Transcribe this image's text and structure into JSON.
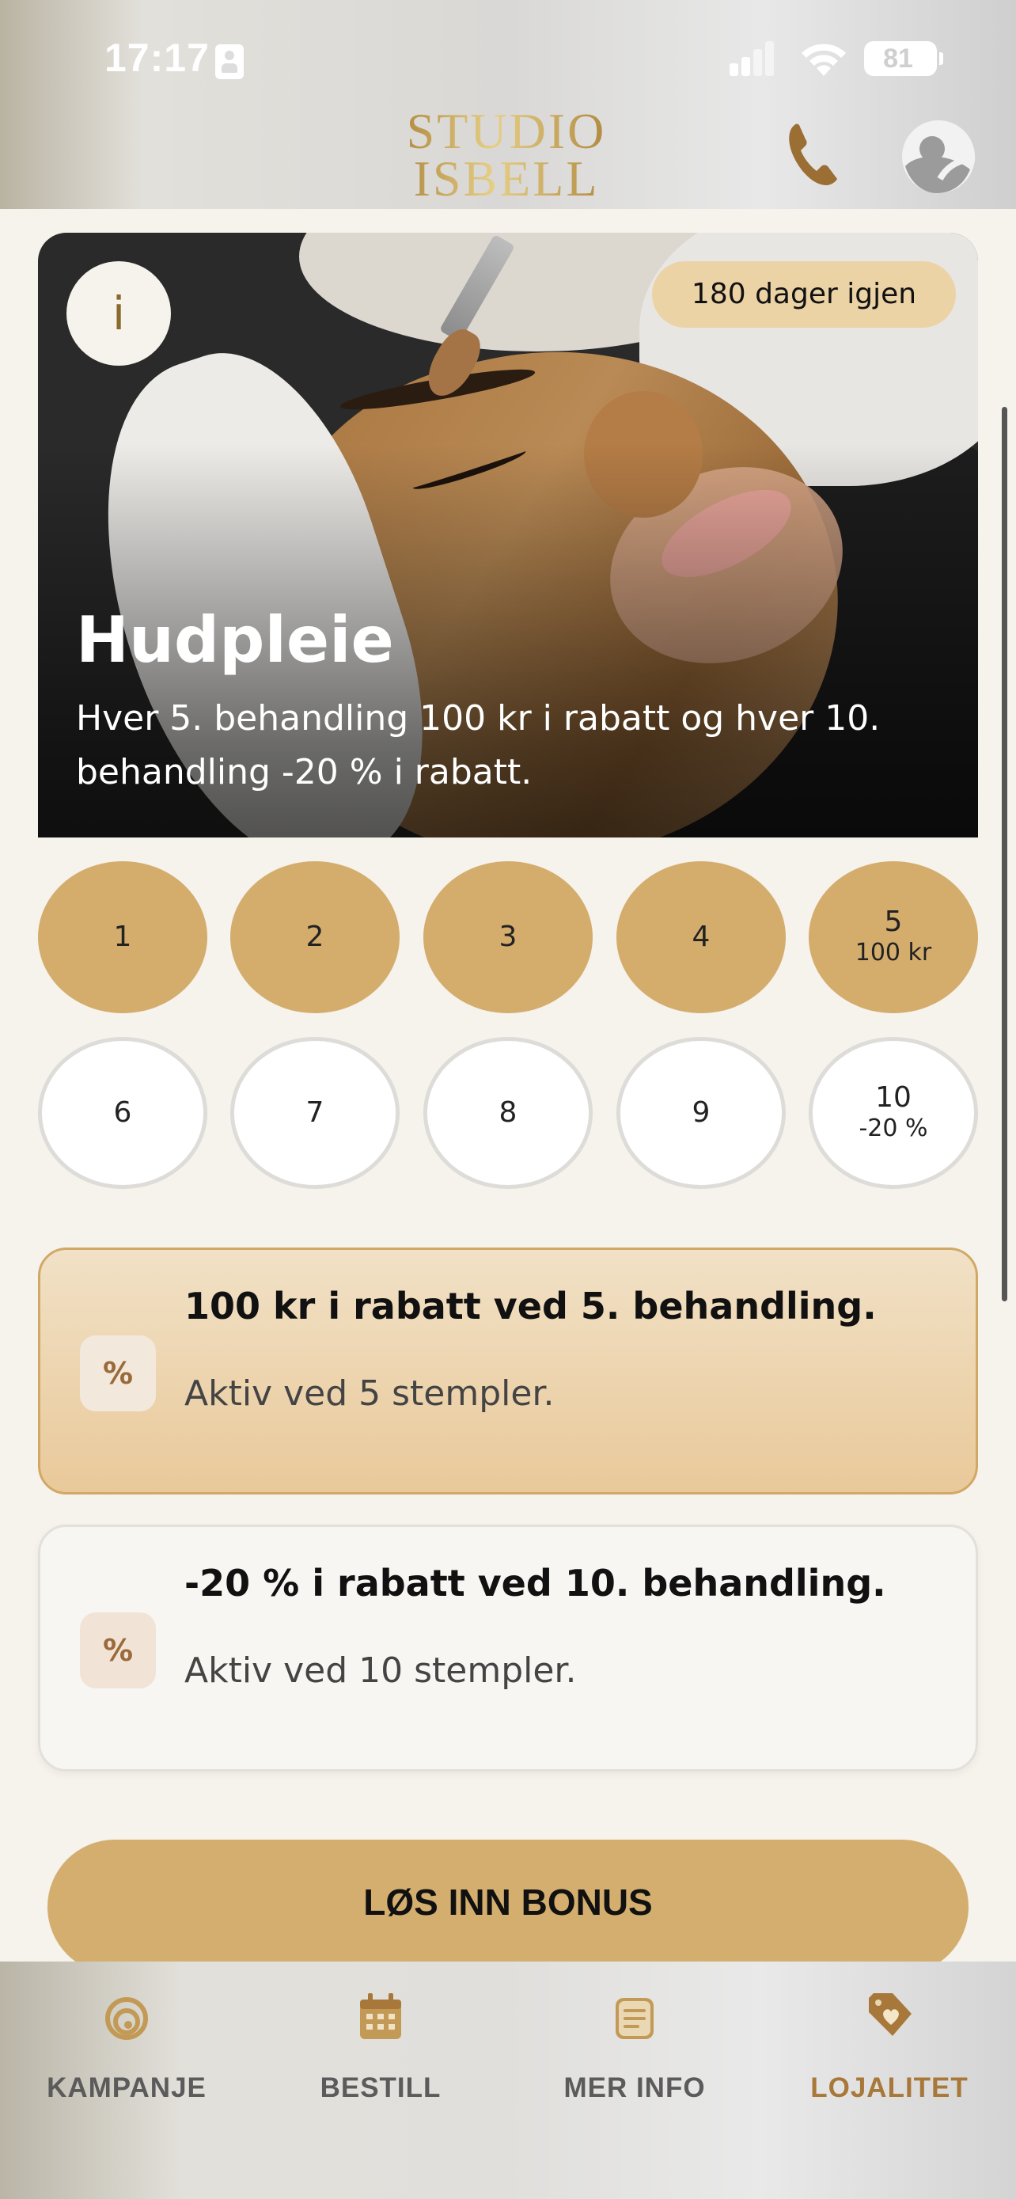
{
  "status_bar": {
    "time": "17:17",
    "battery": "81"
  },
  "header": {
    "logo_line1": "STUDIO",
    "logo_line2": "ISBELL"
  },
  "card": {
    "badge": "180 dager igjen",
    "info_label": "i",
    "title": "Hudpleie",
    "description": "Hver 5. behandling 100 kr i rabatt og hver 10. behandling -20 % i rabatt."
  },
  "stamps": [
    {
      "num": "1",
      "sub": "",
      "filled": true
    },
    {
      "num": "2",
      "sub": "",
      "filled": true
    },
    {
      "num": "3",
      "sub": "",
      "filled": true
    },
    {
      "num": "4",
      "sub": "",
      "filled": true
    },
    {
      "num": "5",
      "sub": "100 kr",
      "filled": true
    },
    {
      "num": "6",
      "sub": "",
      "filled": false
    },
    {
      "num": "7",
      "sub": "",
      "filled": false
    },
    {
      "num": "8",
      "sub": "",
      "filled": false
    },
    {
      "num": "9",
      "sub": "",
      "filled": false
    },
    {
      "num": "10",
      "sub": "-20 %",
      "filled": false
    }
  ],
  "rewards": [
    {
      "icon": "%",
      "title": "100 kr i rabatt ved 5. behandling.",
      "subtitle": "Aktiv ved 5 stempler.",
      "active": true
    },
    {
      "icon": "%",
      "title": "-20 % i rabatt ved 10. behandling.",
      "subtitle": "Aktiv ved 10 stempler.",
      "active": false
    }
  ],
  "redeem_label": "LØS INN BONUS",
  "tabs": [
    {
      "label": "KAMPANJE",
      "icon": "campaign-swirl-icon"
    },
    {
      "label": "BESTILL",
      "icon": "calendar-icon"
    },
    {
      "label": "MER INFO",
      "icon": "document-icon"
    },
    {
      "label": "LOJALITET",
      "icon": "heart-tag-icon",
      "active": true
    }
  ],
  "colors": {
    "gold": "#d4ad6d",
    "gold_dark": "#a8783a",
    "background": "#f6f2ec"
  }
}
